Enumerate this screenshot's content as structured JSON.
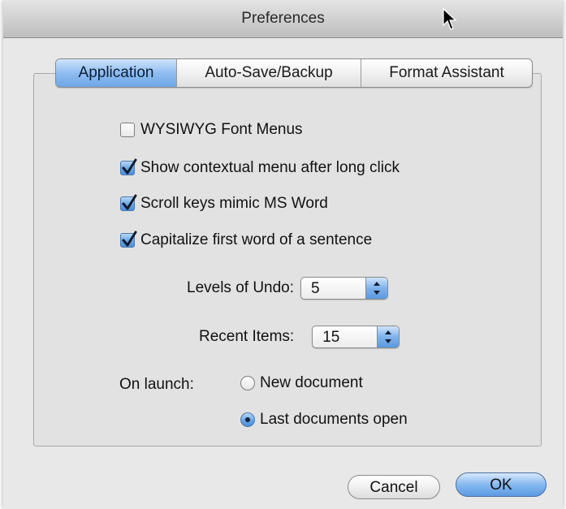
{
  "window": {
    "title": "Preferences"
  },
  "tabs": [
    {
      "label": "Application",
      "active": true
    },
    {
      "label": "Auto-Save/Backup",
      "active": false
    },
    {
      "label": "Format Assistant",
      "active": false
    }
  ],
  "options": [
    {
      "label": "WYSIWYG Font Menus",
      "checked": false
    },
    {
      "label": "Show contextual menu after long click",
      "checked": true
    },
    {
      "label": "Scroll keys mimic MS Word",
      "checked": true
    },
    {
      "label": "Capitalize first word of a sentence",
      "checked": true
    }
  ],
  "undo": {
    "label": "Levels of Undo:",
    "value": "5"
  },
  "recent": {
    "label": "Recent Items:",
    "value": "15"
  },
  "launch": {
    "label": "On launch:",
    "options": [
      {
        "label": "New document",
        "selected": false
      },
      {
        "label": "Last documents open",
        "selected": true
      }
    ]
  },
  "buttons": {
    "cancel": "Cancel",
    "ok": "OK"
  },
  "colors": {
    "accent_blue": "#6da6e6",
    "window_bg": "#e8e8e8"
  },
  "icons": {
    "cursor": "arrow-cursor-icon",
    "check": "checkmark-icon",
    "select_arrows": "up-down-arrows-icon"
  }
}
